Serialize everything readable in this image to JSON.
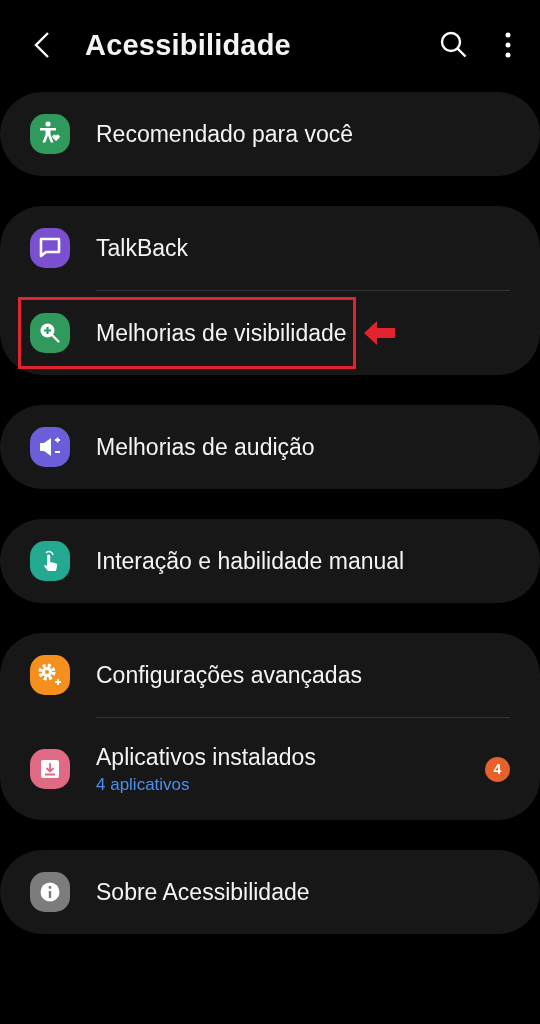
{
  "header": {
    "title": "Acessibilidade"
  },
  "groups": [
    {
      "items": [
        {
          "kind": "person",
          "color": "#2f9a5c",
          "title": "Recomendado para você",
          "highlighted": false
        }
      ]
    },
    {
      "items": [
        {
          "kind": "chat",
          "color": "#7a4fd0",
          "title": "TalkBack",
          "highlighted": false
        },
        {
          "kind": "zoom",
          "color": "#2f9a5c",
          "title": "Melhorias de visibilidade",
          "highlighted": true
        }
      ]
    },
    {
      "items": [
        {
          "kind": "speaker",
          "color": "#6a5fd8",
          "title": "Melhorias de audição",
          "highlighted": false
        }
      ]
    },
    {
      "items": [
        {
          "kind": "hand",
          "color": "#22a98f",
          "title": "Interação e habilidade manual",
          "highlighted": false
        }
      ]
    },
    {
      "items": [
        {
          "kind": "gear",
          "color": "#f5901e",
          "title": "Configurações avançadas",
          "highlighted": false
        },
        {
          "kind": "download",
          "color": "#e06a84",
          "title": "Aplicativos instalados",
          "subtitle": "4 aplicativos",
          "badge": "4",
          "highlighted": false
        }
      ]
    },
    {
      "items": [
        {
          "kind": "info",
          "color": "#7c7c7c",
          "title": "Sobre Acessibilidade",
          "highlighted": false
        }
      ]
    }
  ]
}
